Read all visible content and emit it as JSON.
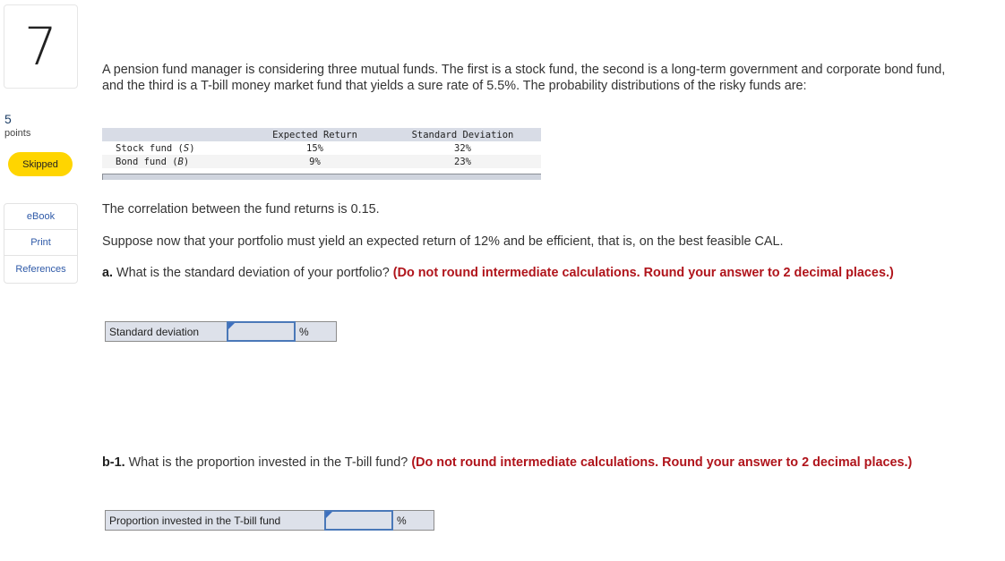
{
  "sidebar": {
    "question_number": "7",
    "points_value": "5",
    "points_label": "points",
    "status": "Skipped",
    "status_color": "#ffd500",
    "links": [
      {
        "label": "eBook"
      },
      {
        "label": "Print"
      },
      {
        "label": "References"
      }
    ]
  },
  "question": {
    "intro": "A pension fund manager is considering three mutual funds. The first is a stock fund, the second is a long-term government and corporate bond fund, and the third is a T-bill money market fund that yields a sure rate of 5.5%. The probability distributions of the risky funds are:",
    "table": {
      "headers": [
        "",
        "Expected Return",
        "Standard Deviation"
      ],
      "rows": [
        {
          "name": "Stock fund (",
          "symbol": "S",
          "close": ")",
          "expected_return": "15%",
          "std_dev": "32%"
        },
        {
          "name": "Bond fund (",
          "symbol": "B",
          "close": ")",
          "expected_return": "9%",
          "std_dev": "23%"
        }
      ]
    },
    "correlation_text": "The correlation between the fund returns is 0.15.",
    "suppose_text": "Suppose now that your portfolio must yield an expected return of 12% and be efficient, that is, on the best feasible CAL.",
    "part_a": {
      "prefix": "a.",
      "text": " What is the standard deviation of your portfolio? ",
      "instruction": "(Do not round intermediate calculations. Round your answer to 2 decimal places.)",
      "answer_label": "Standard deviation",
      "answer_value": "",
      "unit": "%"
    },
    "part_b1": {
      "prefix": "b-1.",
      "text": " What is the proportion invested in the T-bill fund? ",
      "instruction": "(Do not round intermediate calculations. Round your answer to 2 decimal places.)",
      "answer_label": "Proportion invested in the T-bill fund",
      "answer_value": "",
      "unit": "%"
    }
  },
  "colors": {
    "instruction_red": "#b0141b",
    "link_blue": "#2f5aa8",
    "input_border": "#4a78b8"
  }
}
